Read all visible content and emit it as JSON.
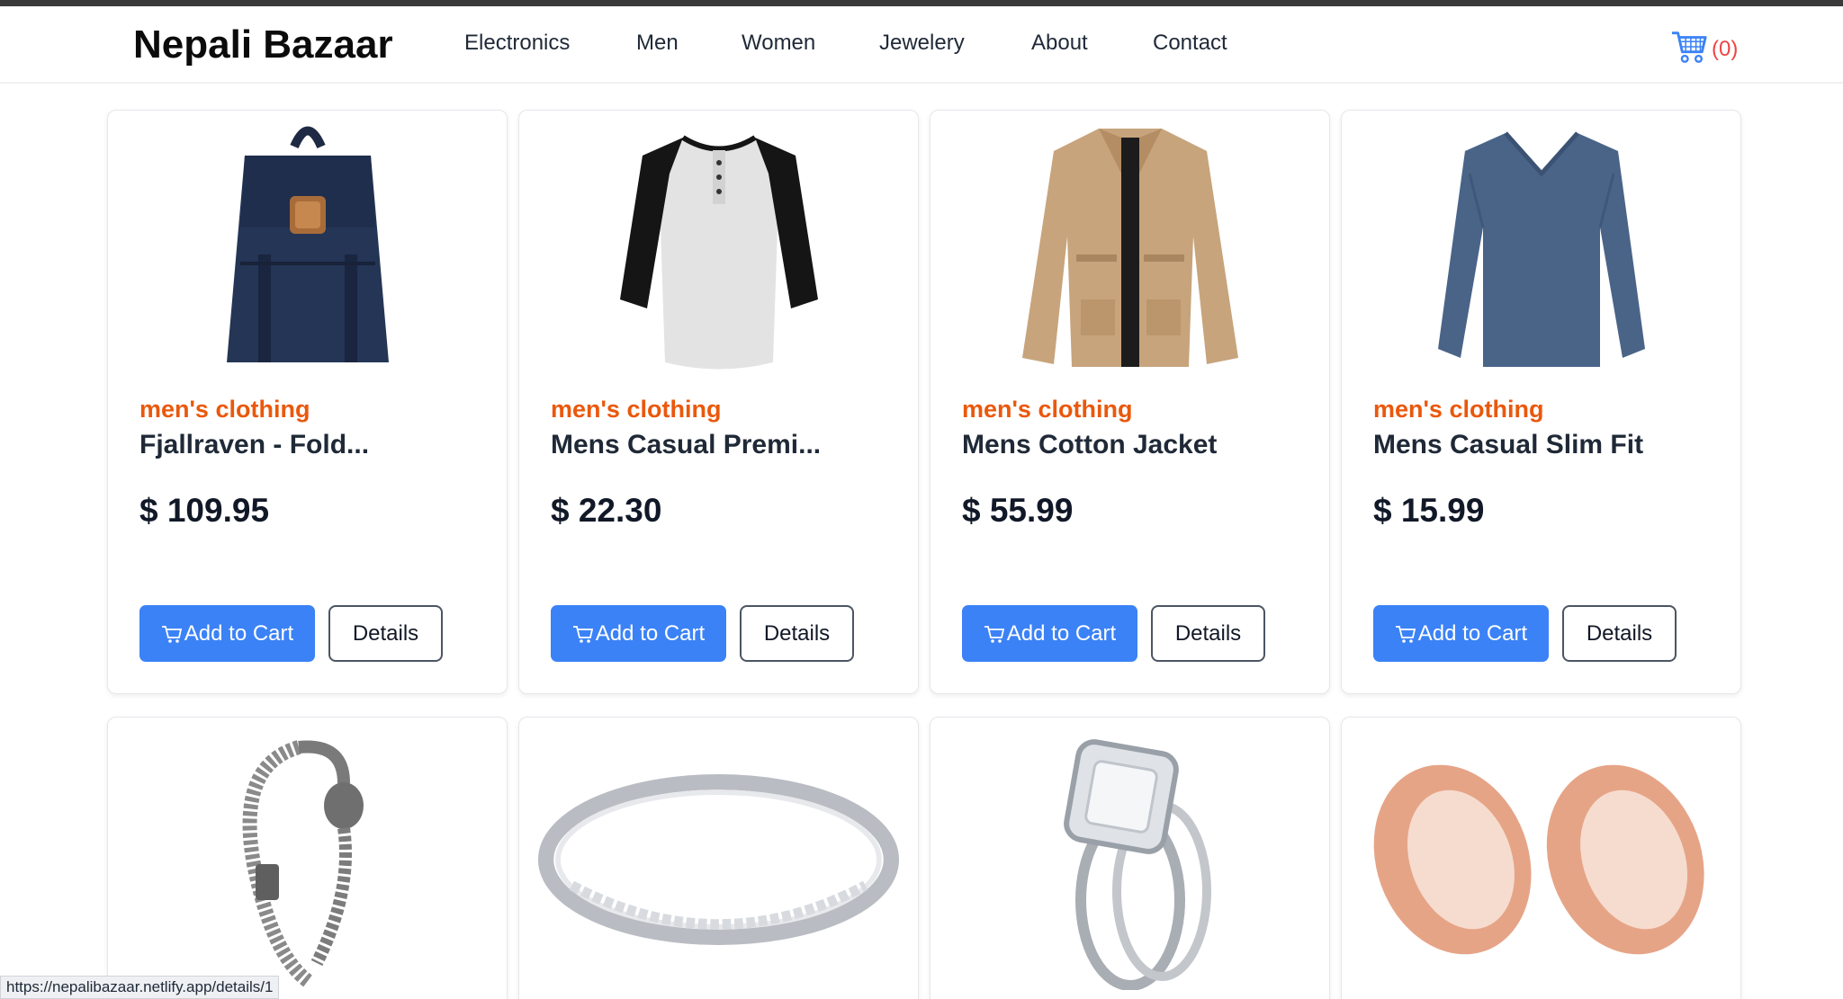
{
  "nav": {
    "brand": "Nepali Bazaar",
    "links": [
      "Electronics",
      "Men",
      "Women",
      "Jewelery",
      "About",
      "Contact"
    ],
    "cart_count": "(0)"
  },
  "products": [
    {
      "category": "men's clothing",
      "title": "Fjallraven - Fold...",
      "price": "$ 109.95",
      "image": "backpack-image"
    },
    {
      "category": "men's clothing",
      "title": "Mens Casual Premi...",
      "price": "$ 22.30",
      "image": "raglan-shirt-image"
    },
    {
      "category": "men's clothing",
      "title": "Mens Cotton Jacket",
      "price": "$ 55.99",
      "image": "jacket-image"
    },
    {
      "category": "men's clothing",
      "title": "Mens Casual Slim Fit",
      "price": "$ 15.99",
      "image": "longsleeve-shirt-image"
    },
    {
      "image": "dragon-bracelet-image"
    },
    {
      "image": "eternity-band-ring-image"
    },
    {
      "image": "halo-engagement-ring-image"
    },
    {
      "image": "rose-gold-tunnel-plugs-image"
    }
  ],
  "buttons": {
    "add_to_cart": "Add to Cart",
    "details": "Details"
  },
  "status_bar": {
    "url": "https://nepalibazaar.netlify.app/details/1"
  },
  "colors": {
    "accent": "#3b82f6",
    "category": "#ea580c",
    "cart_count": "#ef4444"
  }
}
